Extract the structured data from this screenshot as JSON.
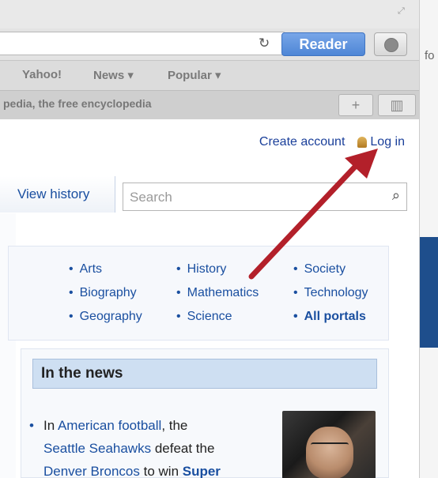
{
  "browser": {
    "reader_label": "Reader",
    "bookmarks": [
      "Yahoo!",
      "News ▾",
      "Popular ▾"
    ],
    "tab_title": "pedia, the free encyclopedia",
    "tab_buttons": [
      "+",
      "▥"
    ]
  },
  "page": {
    "user_links": {
      "create_account": "Create account",
      "log_in": "Log in"
    },
    "view_history": "View history",
    "search_placeholder": "Search",
    "portals": {
      "col1": [
        "Arts",
        "Biography",
        "Geography"
      ],
      "col2": [
        "History",
        "Mathematics",
        "Science"
      ],
      "col3": [
        "Society",
        "Technology",
        "All portals"
      ]
    },
    "news": {
      "heading": "In the news",
      "t1": "In ",
      "l1": "American football",
      "t2": ", the",
      "l2": "Seattle Seahawks",
      "t3": " defeat the",
      "l3": "Denver Broncos",
      "t4": " to win ",
      "l4": "Super"
    }
  },
  "right_strip": {
    "text": "fo"
  },
  "annotation": {
    "arrow_color": "#b3202a"
  }
}
